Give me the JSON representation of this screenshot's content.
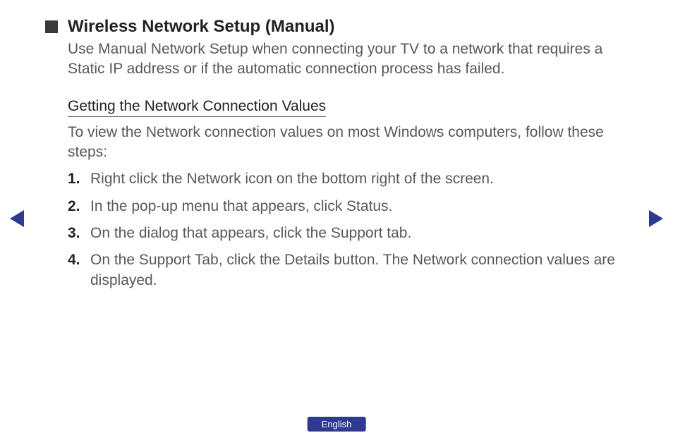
{
  "heading": "Wireless Network Setup (Manual)",
  "intro": "Use Manual Network Setup when connecting your TV to a network that requires a Static IP address or if the automatic connection process has failed.",
  "subheading": "Getting the Network Connection Values",
  "subintro": "To view the Network connection values on most Windows computers, follow these steps:",
  "steps": [
    {
      "num": "1.",
      "text": "Right click the Network icon on the bottom right of the screen."
    },
    {
      "num": "2.",
      "text": "In the pop-up menu that appears, click Status."
    },
    {
      "num": "3.",
      "text": "On the dialog that appears, click the Support tab."
    },
    {
      "num": "4.",
      "text": "On the Support Tab, click the Details button. The Network connection values are displayed."
    }
  ],
  "language": "English"
}
